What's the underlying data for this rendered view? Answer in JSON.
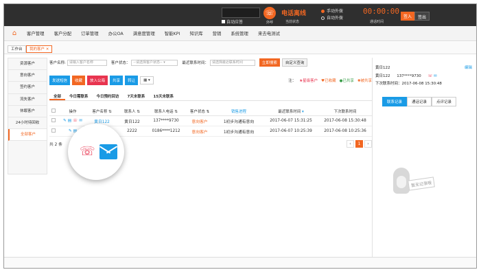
{
  "topbar": {
    "auto_answer_label": "自动应答",
    "dial_label": "外呼",
    "line_status": "电话离线",
    "line_status_sub": "当前状态",
    "manual_dial": "手动外拨",
    "auto_dial": "自动外拨",
    "timer": "00:00:00",
    "timer_sub": "通话时间",
    "sign_in": "签入",
    "sign_out": "签出"
  },
  "nav": {
    "items": [
      "客户管理",
      "客户分配",
      "订单管理",
      "办公OA",
      "满意度管理",
      "智能KPI",
      "知识库",
      "营销",
      "系统管理",
      "来去电测试"
    ]
  },
  "tabs": {
    "workbench": "工作台",
    "my_customers": "我的客户"
  },
  "sidebar": {
    "items": [
      "资源客户",
      "意向客户",
      "签约客户",
      "流失客户",
      "休眠客户",
      "24小时待回收",
      "全部客户"
    ]
  },
  "filters": {
    "name_label": "客户名称:",
    "name_placeholder": "请输入客户名称",
    "status_label": "客户状态：",
    "status_placeholder": "--请选择客户状态--",
    "last_contact_label": "最近联系时间：",
    "last_contact_placeholder": "请选择最近联系时间",
    "search_btn": "立即搜索",
    "custom_query_btn": "自定义查询"
  },
  "actions": {
    "sms": "发送短信",
    "favorite": "收藏",
    "public_pool": "放入公海",
    "share": "共享",
    "transfer": "转让",
    "grid_icon": "▦ ▾"
  },
  "legend": {
    "note": "注：",
    "star": "★星级客户",
    "fav": "♥已收藏",
    "shared": "●已共享",
    "shared_by": "✺被共享"
  },
  "subtabs": [
    "全部",
    "今日需联系",
    "今日预约回访",
    "7天未联系",
    "15天未联系"
  ],
  "table": {
    "headers": [
      "操作",
      "客户名称 ⇅",
      "联系人 ⇅",
      "联系人电话 ⇅",
      "客户状态 ⇅",
      "销售进程",
      "最近联系时间",
      "下次联系时间"
    ],
    "rows": [
      {
        "name": "黄日122",
        "contact": "黄日122",
        "phone": "137****9730",
        "status": "意向客户",
        "process": "1初步沟通有意向",
        "last": "2017-06-07 15:31:25",
        "next": "2017-06-08 15:30:48"
      },
      {
        "name": "2222",
        "contact": "2222",
        "phone": "0186****1212",
        "status": "意向客户",
        "process": "1初步沟通有意向",
        "last": "2017-06-07 10:25:39",
        "next": "2017-06-08 10:25:36"
      }
    ],
    "total": "共 2 条",
    "current_page": "1"
  },
  "right_panel": {
    "title": "黄日122",
    "edit": "编辑",
    "contact_name": "黄日122",
    "contact_phone": "137****9730",
    "next_contact": "下次联系时间：2017-06-08 15:30:48",
    "tabs": [
      "联系记录",
      "通话记录",
      "点评记录"
    ],
    "empty_text": "暂无记录哦"
  },
  "colors": {
    "accent": "#f26722",
    "blue": "#1a9be6",
    "red": "#e8344f"
  }
}
